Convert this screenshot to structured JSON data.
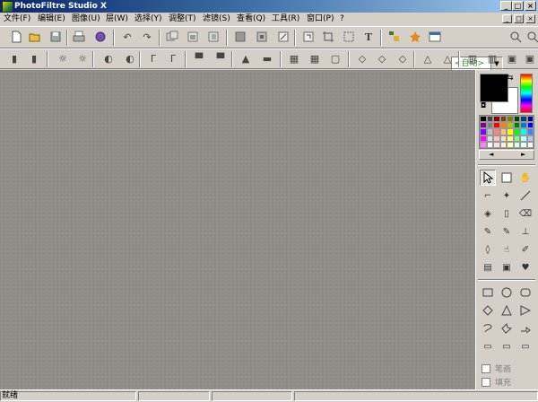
{
  "window": {
    "title": "PhotoFiltre Studio X",
    "min": "_",
    "max": "□",
    "close": "×"
  },
  "menu": [
    "文件(F)",
    "编辑(E)",
    "图像(U)",
    "层(W)",
    "选择(Y)",
    "调整(T)",
    "滤镜(S)",
    "查看(Q)",
    "工具(R)",
    "窗口(P)",
    "?"
  ],
  "toolbar": {
    "zoom_combo": "<自动>"
  },
  "colors": {
    "foreground": "#000000",
    "background": "#ffffff",
    "workspace": "#8e8e86"
  },
  "palette": [
    "#000000",
    "#404040",
    "#800000",
    "#804000",
    "#808000",
    "#004000",
    "#004080",
    "#000080",
    "#800080",
    "#808080",
    "#ff0000",
    "#ff8000",
    "#c0c000",
    "#008000",
    "#0080c0",
    "#0000ff",
    "#8000ff",
    "#c0c0c0",
    "#ff8080",
    "#ffc080",
    "#ffff00",
    "#00ff00",
    "#00ffff",
    "#4080ff",
    "#ff00ff",
    "#e0e0e0",
    "#ffc0c0",
    "#ffe0c0",
    "#ffff80",
    "#80ff80",
    "#c0ffff",
    "#c0c0ff",
    "#ff80ff",
    "#ffffff",
    "#ffe0e0",
    "#fff0e0",
    "#ffffc0",
    "#e0ffe0",
    "#e0ffff",
    "#ffffff"
  ],
  "tools": {
    "stroke_label": "笔画",
    "fill_label": "填充"
  },
  "status": {
    "text": "就绪"
  }
}
